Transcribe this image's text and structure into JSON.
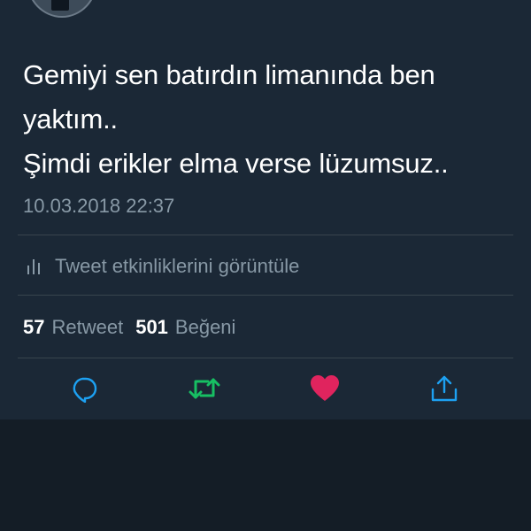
{
  "tweet": {
    "text_lines": [
      "Gemiyi sen batırdın limanında ben",
      "yaktım..",
      "Şimdi erikler elma verse lüzumsuz.."
    ],
    "timestamp": "10.03.2018 22:37"
  },
  "analytics": {
    "label": "Tweet etkinliklerini görüntüle",
    "icon": "bar-chart-icon"
  },
  "stats": {
    "retweet_count": "57",
    "retweet_label": "Retweet",
    "like_count": "501",
    "like_label": "Beğeni"
  },
  "actions": [
    {
      "name": "reply",
      "icon": "reply-icon",
      "color": "#1da1f2"
    },
    {
      "name": "retweet",
      "icon": "retweet-icon",
      "color": "#17bf63",
      "active": true
    },
    {
      "name": "like",
      "icon": "heart-icon",
      "color": "#e0245e",
      "active": true
    },
    {
      "name": "share",
      "icon": "share-icon",
      "color": "#1da1f2"
    }
  ],
  "colors": {
    "card_background": "#1b2836",
    "page_background": "#141d26",
    "text_primary": "#ffffff",
    "text_secondary": "#8899a6",
    "divider": "#38444d",
    "accent_blue": "#1da1f2",
    "retweet_green": "#17bf63",
    "like_red": "#e0245e"
  }
}
